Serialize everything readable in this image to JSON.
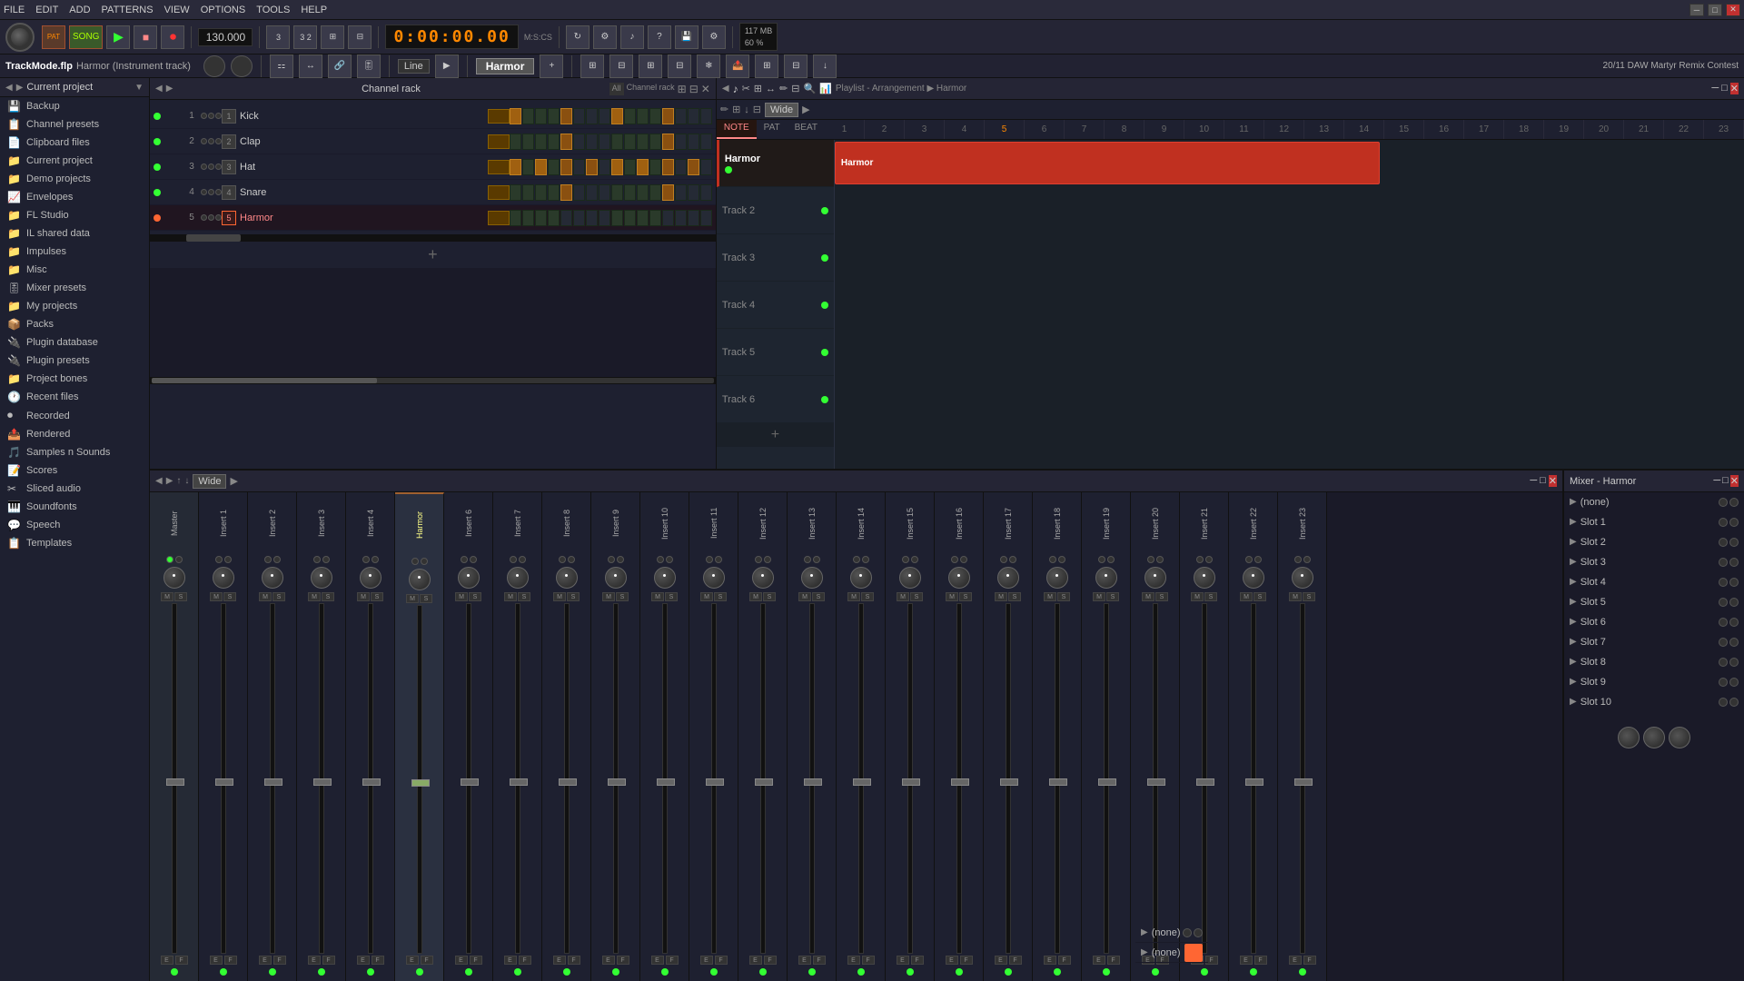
{
  "titlebar": {
    "menus": [
      "FILE",
      "EDIT",
      "ADD",
      "PATTERNS",
      "VIEW",
      "OPTIONS",
      "TOOLS",
      "HELP"
    ],
    "window_controls": [
      "─",
      "□",
      "✕"
    ],
    "project_name": "TrackMode.flp",
    "track_info": "Harmor (Instrument track)"
  },
  "toolbar": {
    "song_label": "SONG",
    "tempo": "130.000",
    "time": "0:00:00.00",
    "time_label": "M:S:CS",
    "pattern_label": "PAT",
    "numerator": "3",
    "denominator": "2"
  },
  "infobar": {
    "project_path": "20/11  DAW Martyr Remix Contest",
    "view_label": "Line"
  },
  "sidebar": {
    "header": "Current project",
    "items": [
      {
        "id": "backup",
        "icon": "💾",
        "label": "Backup"
      },
      {
        "id": "channel-presets",
        "icon": "📋",
        "label": "Channel presets"
      },
      {
        "id": "clipboard-files",
        "icon": "📄",
        "label": "Clipboard files"
      },
      {
        "id": "current-project",
        "icon": "📁",
        "label": "Current project"
      },
      {
        "id": "demo-projects",
        "icon": "📁",
        "label": "Demo projects"
      },
      {
        "id": "envelopes",
        "icon": "📈",
        "label": "Envelopes"
      },
      {
        "id": "fl-studio",
        "icon": "📁",
        "label": "FL Studio"
      },
      {
        "id": "il-shared-data",
        "icon": "📁",
        "label": "IL shared data"
      },
      {
        "id": "impulses",
        "icon": "📁",
        "label": "Impulses"
      },
      {
        "id": "misc",
        "icon": "📁",
        "label": "Misc"
      },
      {
        "id": "mixer-presets",
        "icon": "🎚",
        "label": "Mixer presets"
      },
      {
        "id": "my-projects",
        "icon": "📁",
        "label": "My projects"
      },
      {
        "id": "packs",
        "icon": "📦",
        "label": "Packs"
      },
      {
        "id": "plugin-database",
        "icon": "🔌",
        "label": "Plugin database"
      },
      {
        "id": "plugin-presets",
        "icon": "🔌",
        "label": "Plugin presets"
      },
      {
        "id": "project-bones",
        "icon": "📁",
        "label": "Project bones"
      },
      {
        "id": "recent-files",
        "icon": "🕐",
        "label": "Recent files"
      },
      {
        "id": "recorded",
        "icon": "⏺",
        "label": "Recorded"
      },
      {
        "id": "rendered",
        "icon": "📤",
        "label": "Rendered"
      },
      {
        "id": "samples-n-sounds",
        "icon": "🎵",
        "label": "Samples n Sounds"
      },
      {
        "id": "scores",
        "icon": "📝",
        "label": "Scores"
      },
      {
        "id": "sliced-audio",
        "icon": "✂",
        "label": "Sliced audio"
      },
      {
        "id": "soundfonts",
        "icon": "🎹",
        "label": "Soundfonts"
      },
      {
        "id": "speech",
        "icon": "💬",
        "label": "Speech"
      },
      {
        "id": "templates",
        "icon": "📋",
        "label": "Templates"
      }
    ]
  },
  "channel_rack": {
    "title": "Channel rack",
    "channels": [
      {
        "num": 1,
        "name": "Kick",
        "color": "#3f3"
      },
      {
        "num": 2,
        "name": "Clap",
        "color": "#3f3"
      },
      {
        "num": 3,
        "name": "Hat",
        "color": "#3f3"
      },
      {
        "num": 4,
        "name": "Snare",
        "color": "#3f3"
      },
      {
        "num": 5,
        "name": "Harmor",
        "color": "#f63"
      }
    ],
    "steps": 16
  },
  "playlist": {
    "title": "Playlist - Arrangement",
    "subtitle": "Harmor",
    "rulers": [
      1,
      2,
      3,
      4,
      5,
      6,
      7,
      8,
      9,
      10,
      11,
      12,
      13,
      14,
      15,
      16,
      17,
      18,
      19,
      20,
      21,
      22,
      23
    ],
    "tracks": [
      {
        "name": "Harmor",
        "has_block": true,
        "block_start": 1,
        "block_width": 20
      },
      {
        "name": "Track 2",
        "has_block": false
      },
      {
        "name": "Track 3",
        "has_block": false
      },
      {
        "name": "Track 4",
        "has_block": false
      },
      {
        "name": "Track 5",
        "has_block": false
      },
      {
        "name": "Track 6",
        "has_block": false
      }
    ]
  },
  "mixer": {
    "title": "Mixer - Harmor",
    "channels": [
      {
        "name": "Master",
        "is_master": true
      },
      {
        "name": "Insert 1"
      },
      {
        "name": "Insert 2"
      },
      {
        "name": "Insert 3"
      },
      {
        "name": "Insert 4"
      },
      {
        "name": "Harmor",
        "selected": true
      },
      {
        "name": "Insert 6"
      },
      {
        "name": "Insert 7"
      },
      {
        "name": "Insert 8"
      },
      {
        "name": "Insert 9"
      },
      {
        "name": "Insert 10"
      },
      {
        "name": "Insert 11"
      },
      {
        "name": "Insert 12"
      },
      {
        "name": "Insert 13"
      },
      {
        "name": "Insert 14"
      },
      {
        "name": "Insert 15"
      },
      {
        "name": "Insert 16"
      },
      {
        "name": "Insert 17"
      },
      {
        "name": "Insert 18"
      },
      {
        "name": "Insert 19"
      },
      {
        "name": "Insert 20"
      },
      {
        "name": "Insert 21"
      },
      {
        "name": "Insert 22"
      },
      {
        "name": "Insert 23"
      }
    ]
  },
  "mixer_right": {
    "title": "Mixer - Harmor",
    "slots": [
      {
        "name": "(none)"
      },
      {
        "name": "Slot 1"
      },
      {
        "name": "Slot 2"
      },
      {
        "name": "Slot 3"
      },
      {
        "name": "Slot 4"
      },
      {
        "name": "Slot 5"
      },
      {
        "name": "Slot 6"
      },
      {
        "name": "Slot 7"
      },
      {
        "name": "Slot 8"
      },
      {
        "name": "Slot 9"
      },
      {
        "name": "Slot 10"
      }
    ],
    "send_slots": [
      {
        "name": "(none)"
      },
      {
        "name": "(none)"
      }
    ]
  }
}
